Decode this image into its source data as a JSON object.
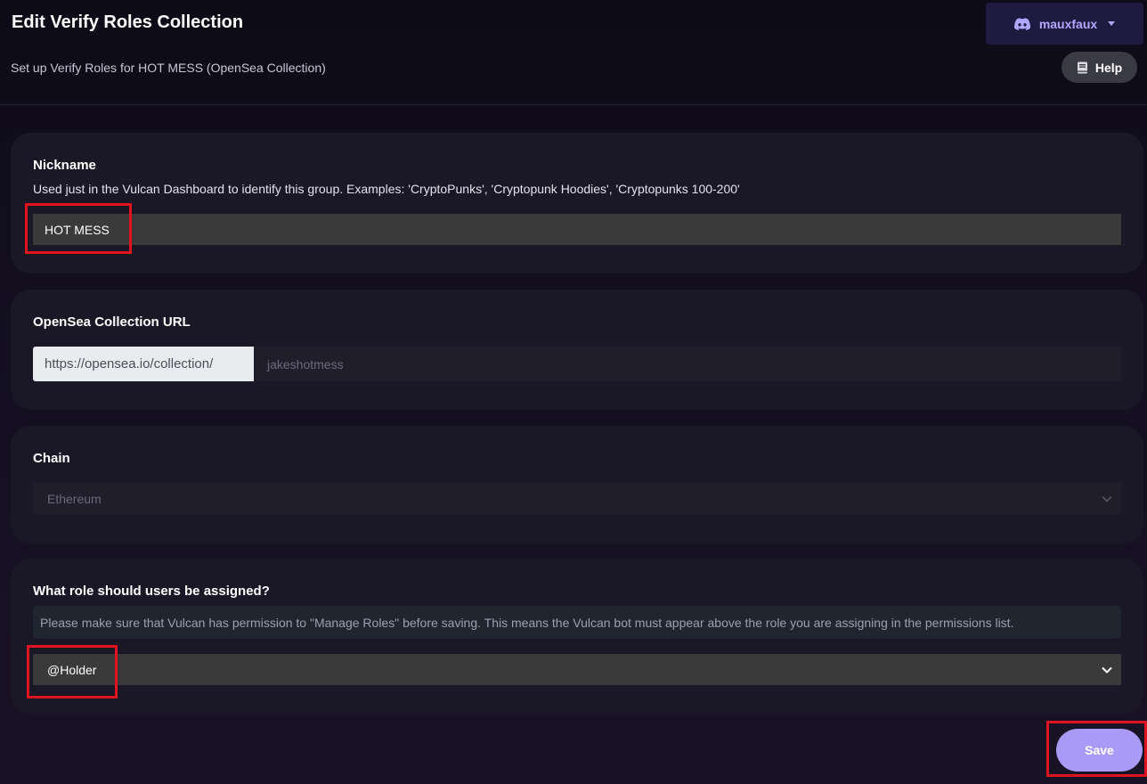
{
  "header": {
    "title": "Edit Verify Roles Collection",
    "subtitle": "Set up Verify Roles for HOT MESS (OpenSea Collection)",
    "user_name": "mauxfaux",
    "help_label": "Help"
  },
  "nickname": {
    "label": "Nickname",
    "description": "Used just in the Vulcan Dashboard to identify this group. Examples: 'CryptoPunks', 'Cryptopunk Hoodies', 'Cryptopunks 100-200'",
    "value": "HOT MESS"
  },
  "opensea": {
    "label": "OpenSea Collection URL",
    "prefix": "https://opensea.io/collection/",
    "value": "jakeshotmess"
  },
  "chain": {
    "label": "Chain",
    "selected": "Ethereum"
  },
  "role": {
    "label": "What role should users be assigned?",
    "notice": "Please make sure that Vulcan has permission to \"Manage Roles\" before saving. This means the Vulcan bot must appear above the role you are assigning in the permissions list.",
    "selected": "@Holder"
  },
  "actions": {
    "save_label": "Save"
  },
  "colors": {
    "accent": "#a99bf5",
    "user_button_bg": "#1f1a40",
    "highlight": "#e0141e"
  },
  "icons": {
    "user": "discord-icon",
    "help": "book-icon",
    "select": "chevron-down-icon"
  }
}
